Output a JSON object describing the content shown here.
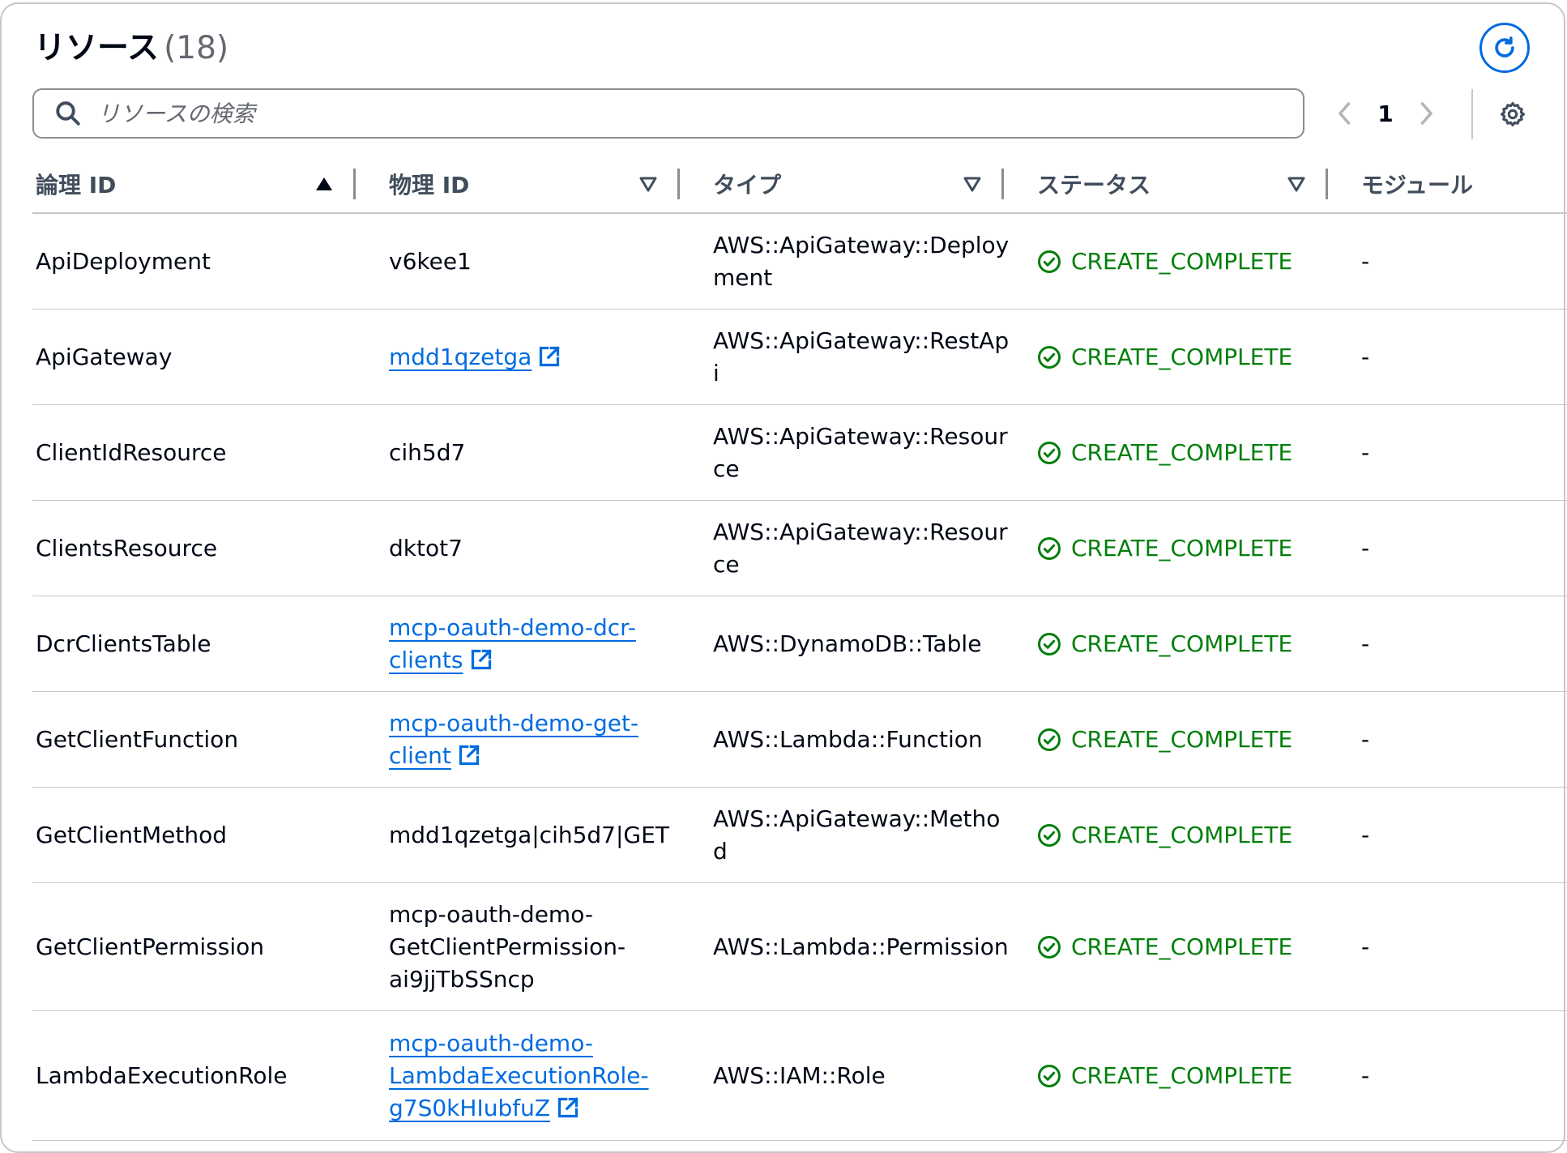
{
  "header": {
    "title": "リソース",
    "count": "(18)"
  },
  "search": {
    "placeholder": "リソースの検索"
  },
  "pagination": {
    "current_page": "1"
  },
  "columns": [
    {
      "label": "論理 ID",
      "sort": "ascending"
    },
    {
      "label": "物理 ID",
      "sort": "none"
    },
    {
      "label": "タイプ",
      "sort": "none"
    },
    {
      "label": "ステータス",
      "sort": "none"
    },
    {
      "label": "モジュール"
    }
  ],
  "rows": [
    {
      "logical_id": "ApiDeployment",
      "physical_id": "v6kee1",
      "physical_is_link": false,
      "type": "AWS::ApiGateway::Deployment",
      "status": "CREATE_COMPLETE",
      "module": "-"
    },
    {
      "logical_id": "ApiGateway",
      "physical_id": "mdd1qzetga",
      "physical_is_link": true,
      "type": "AWS::ApiGateway::RestApi",
      "status": "CREATE_COMPLETE",
      "module": "-"
    },
    {
      "logical_id": "ClientIdResource",
      "physical_id": "cih5d7",
      "physical_is_link": false,
      "type": "AWS::ApiGateway::Resource",
      "status": "CREATE_COMPLETE",
      "module": "-"
    },
    {
      "logical_id": "ClientsResource",
      "physical_id": "dktot7",
      "physical_is_link": false,
      "type": "AWS::ApiGateway::Resource",
      "status": "CREATE_COMPLETE",
      "module": "-"
    },
    {
      "logical_id": "DcrClientsTable",
      "physical_id": "mcp-oauth-demo-dcr-clients",
      "physical_is_link": true,
      "type": "AWS::DynamoDB::Table",
      "status": "CREATE_COMPLETE",
      "module": "-"
    },
    {
      "logical_id": "GetClientFunction",
      "physical_id": "mcp-oauth-demo-get-client",
      "physical_is_link": true,
      "type": "AWS::Lambda::Function",
      "status": "CREATE_COMPLETE",
      "module": "-"
    },
    {
      "logical_id": "GetClientMethod",
      "physical_id": "mdd1qzetga|cih5d7|GET",
      "physical_is_link": false,
      "type": "AWS::ApiGateway::Method",
      "status": "CREATE_COMPLETE",
      "module": "-"
    },
    {
      "logical_id": "GetClientPermission",
      "physical_id": "mcp-oauth-demo-GetClientPermission-ai9jjTbSSncp",
      "physical_is_link": false,
      "type": "AWS::Lambda::Permission",
      "status": "CREATE_COMPLETE",
      "module": "-"
    },
    {
      "logical_id": "LambdaExecutionRole",
      "physical_id": "mcp-oauth-demo-LambdaExecutionRole-g7S0kHIubfuZ",
      "physical_is_link": true,
      "type": "AWS::IAM::Role",
      "status": "CREATE_COMPLETE",
      "module": "-"
    }
  ],
  "colors": {
    "link": "#006ce0",
    "success": "#037f0c",
    "text": "#000716",
    "muted": "#656871",
    "border": "#c6c6cd"
  },
  "icons": [
    "refresh-icon",
    "search-icon",
    "chevron-left-icon",
    "chevron-right-icon",
    "settings-gear-icon",
    "sort-ascending-icon",
    "sort-descending-icon",
    "external-link-icon",
    "success-check-circle-icon"
  ]
}
